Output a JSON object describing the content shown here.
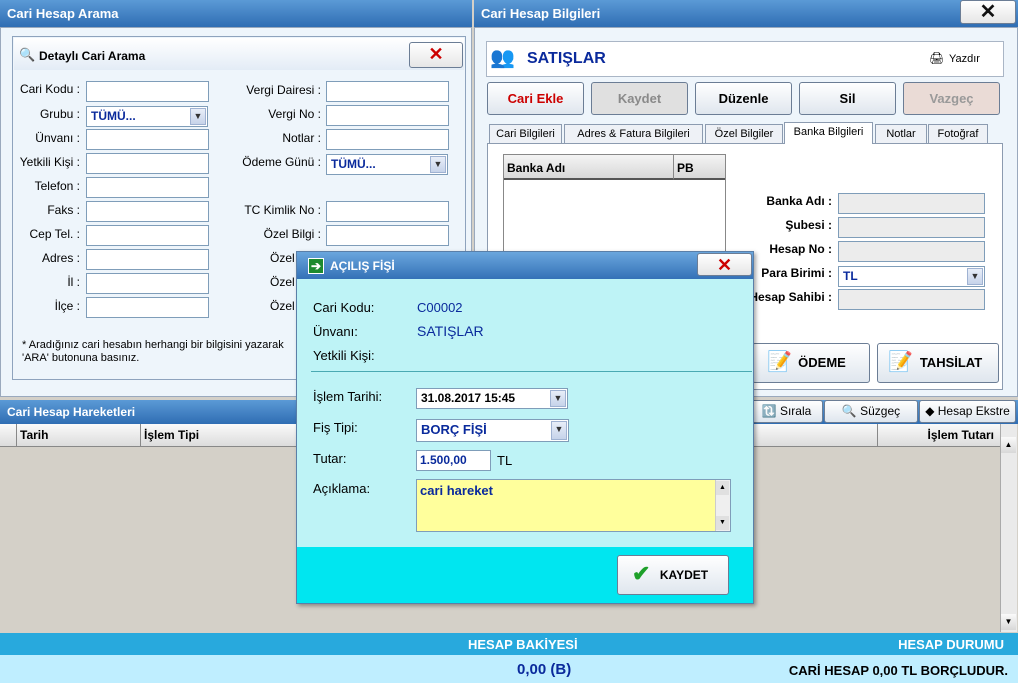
{
  "left_panel": {
    "title": "Cari Hesap Arama",
    "search_box_title": "Detaylı Cari Arama",
    "close_glyph": "✕",
    "labels": {
      "cari_kodu": "Cari Kodu :",
      "grubu": "Grubu :",
      "unvani": "Ünvanı :",
      "yetkili": "Yetkili Kişi :",
      "telefon": "Telefon :",
      "faks": "Faks :",
      "cep": "Cep Tel. :",
      "adres": "Adres :",
      "il": "İl :",
      "ilce": "İlçe :",
      "vergi_dairesi": "Vergi Dairesi :",
      "vergi_no": "Vergi No :",
      "notlar": "Notlar :",
      "odeme_gunu": "Ödeme Günü :",
      "tc_kimlik": "TC Kimlik No :",
      "ozel_bilgi": "Özel Bilgi :",
      "ozel2": "Özel",
      "ozel3": "Özel",
      "ozel4": "Özel"
    },
    "grubu_value": "TÜMÜ...",
    "odeme_gunu_value": "TÜMÜ...",
    "hint": "* Aradığınız cari hesabın herhangi bir bilgisini yazarak 'ARA' butonuna basınız."
  },
  "right_panel": {
    "title": "Cari Hesap Bilgileri",
    "close_glyph": "✕",
    "account_name": "SATIŞLAR",
    "print_label": "Yazdır",
    "buttons": {
      "cari_ekle": "Cari Ekle",
      "kaydet": "Kaydet",
      "duzenle": "Düzenle",
      "sil": "Sil",
      "vazgec": "Vazgeç"
    },
    "tabs": [
      "Cari Bilgileri",
      "Adres & Fatura Bilgileri",
      "Özel Bilgiler",
      "Banka Bilgileri",
      "Notlar",
      "Fotoğraf"
    ],
    "bank_table_headers": [
      "Banka Adı",
      "PB"
    ],
    "bank_labels": {
      "banka_adi": "Banka Adı :",
      "subesi": "Şubesi :",
      "hesap_no": "Hesap No :",
      "para_birimi": "Para Birimi :",
      "hesap_sahibi": "Hesap Sahibi :"
    },
    "para_birimi_value": "TL",
    "odeme_button": "ÖDEME",
    "tahsilat_button": "TAHSİLAT"
  },
  "movements": {
    "title": "Cari Hesap Hareketleri",
    "columns": [
      "Tarih",
      "İşlem Tipi",
      "İşlem Tutarı"
    ],
    "sirala": "Sırala",
    "suzgec": "Süzgeç",
    "hesap_ekstre": "Hesap Ekstre"
  },
  "dialog": {
    "title": "AÇILIŞ FİŞİ",
    "close_glyph": "✕",
    "cari_kodu_label": "Cari Kodu:",
    "cari_kodu_value": "C00002",
    "unvani_label": "Ünvanı:",
    "unvani_value": "SATIŞLAR",
    "yetkili_label": "Yetkili Kişi:",
    "islem_tarihi_label": "İşlem Tarihi:",
    "islem_tarihi_value": "31.08.2017 15:45",
    "fis_tipi_label": "Fiş Tipi:",
    "fis_tipi_value": "BORÇ FİŞİ",
    "tutar_label": "Tutar:",
    "tutar_value": "1.500,00",
    "tutar_unit": "TL",
    "aciklama_label": "Açıklama:",
    "aciklama_value": "cari hareket",
    "save_button": "KAYDET"
  },
  "footer": {
    "balance_label": "HESAP BAKİYESİ",
    "status_label": "HESAP DURUMU",
    "balance_value": "0,00 (B)",
    "status_value": "CARİ HESAP 0,00 TL BORÇLUDUR."
  }
}
